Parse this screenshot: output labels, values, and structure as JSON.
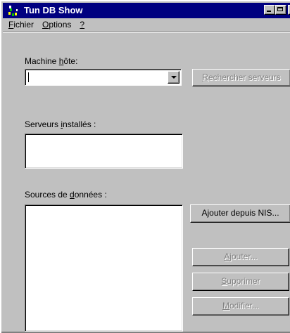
{
  "window": {
    "title": "Tun DB Show",
    "icon": "tun-app-icon",
    "controls": {
      "minimize": "minimize-icon",
      "maximize": "maximize-icon",
      "close_glyph": "✕"
    }
  },
  "menu": {
    "items": [
      {
        "pre": "",
        "accel": "F",
        "post": "ichier"
      },
      {
        "pre": "",
        "accel": "O",
        "post": "ptions"
      },
      {
        "pre": "",
        "accel": "?",
        "post": ""
      }
    ]
  },
  "host": {
    "label_pre": "Machine ",
    "label_accel": "h",
    "label_post": "ôte:",
    "value": "",
    "search_button": {
      "accel": "R",
      "rest": "echercher serveurs",
      "enabled": false
    }
  },
  "servers": {
    "label_pre": "Serveurs ",
    "label_accel": "i",
    "label_post": "nstallés :",
    "items": []
  },
  "sources": {
    "label_pre": "Sources de ",
    "label_accel": "d",
    "label_post": "onnées :",
    "items": []
  },
  "buttons": {
    "add_nis": {
      "label": "Ajouter depuis NIS...",
      "enabled": true
    },
    "add": {
      "accel": "A",
      "rest": "jouter...",
      "enabled": false
    },
    "delete": {
      "accel": "S",
      "rest": "upprimer",
      "enabled": false
    },
    "modify": {
      "accel": "M",
      "rest": "odifier...",
      "enabled": false
    }
  },
  "colors": {
    "face": "#c0c0c0",
    "titlebar": "#000080",
    "disabled_text": "#808080"
  }
}
